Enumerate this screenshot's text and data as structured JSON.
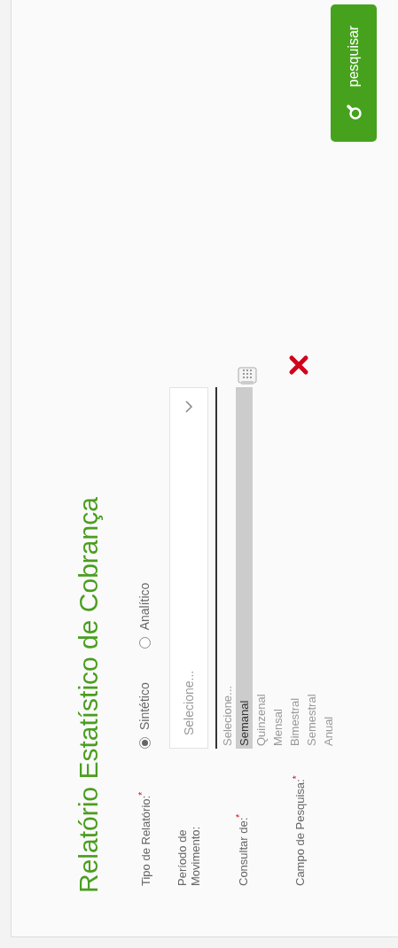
{
  "title": "Relatório Estatístico de Cobrança",
  "fields": [
    {
      "kind": "radio",
      "label": "Tipo de Relatório:$^{*}$",
      "options": [
        {
          "label": "Sintético",
          "selected": true
        },
        {
          "label": "Analítico",
          "selected": false
        }
      ]
    },
    {
      "kind": "select",
      "label": "Período de\nMovimento:",
      "placeholder": "Selecione..."
    },
    {
      "kind": "listbox",
      "label": "Consultar de:$^{*}$",
      "options": [
        {
          "label": "Selecione...",
          "selected": false
        },
        {
          "label": "Semanal",
          "selected": true
        },
        {
          "label": "Quinzenal",
          "selected": false
        },
        {
          "label": "Mensal",
          "selected": false
        },
        {
          "label": "Bimestral",
          "selected": false
        },
        {
          "label": "Semestral",
          "selected": false
        },
        {
          "label": "Anual",
          "selected": false
        }
      ]
    },
    {
      "kind": "search",
      "label": "Campo de Pesquisa:$^{*}$"
    }
  ],
  "search_button": {
    "label": "pesquisar"
  }
}
